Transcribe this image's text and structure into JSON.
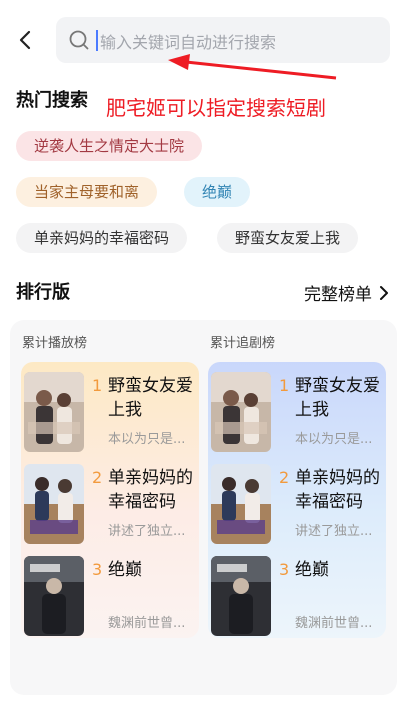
{
  "header": {
    "search_placeholder": "输入关键词自动进行搜索"
  },
  "annotation": {
    "text": "肥宅姬可以指定搜索短剧",
    "color": "#ee1c24"
  },
  "hot_search": {
    "title": "热门搜索",
    "tags": [
      "逆袭人生之情定大士院",
      "当家主母要和离",
      "绝巅",
      "单亲妈妈的幸福密码",
      "野蛮女友爱上我"
    ]
  },
  "ranking": {
    "title": "排行版",
    "full_list_label": "完整榜单",
    "columns": [
      {
        "label": "累计播放榜",
        "items": [
          {
            "rank": "1",
            "title": "野蛮女友爱上我",
            "desc": "本以为只是..."
          },
          {
            "rank": "2",
            "title": "单亲妈妈的幸福密码",
            "desc": "讲述了独立..."
          },
          {
            "rank": "3",
            "title": "绝巅",
            "desc": "魏渊前世曾..."
          }
        ]
      },
      {
        "label": "累计追剧榜",
        "items": [
          {
            "rank": "1",
            "title": "野蛮女友爱上我",
            "desc": "本以为只是..."
          },
          {
            "rank": "2",
            "title": "单亲妈妈的幸福密码",
            "desc": "讲述了独立..."
          },
          {
            "rank": "3",
            "title": "绝巅",
            "desc": "魏渊前世曾..."
          }
        ]
      }
    ]
  },
  "colors": {
    "accent_rank": "#f29a3d",
    "caret": "#4b7bff"
  }
}
